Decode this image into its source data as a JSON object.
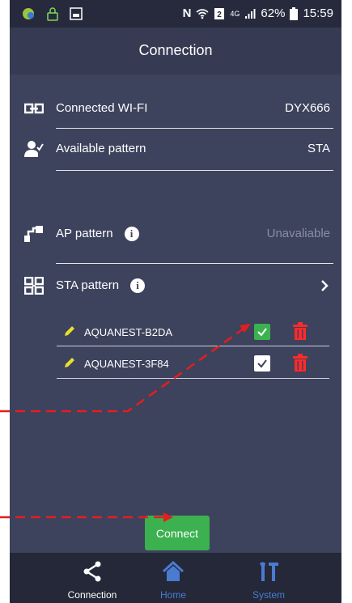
{
  "status_bar": {
    "battery_percent": "62%",
    "time": "15:59",
    "network": "4G"
  },
  "header": {
    "title": "Connection"
  },
  "info": {
    "connected_wifi_label": "Connected WI-FI",
    "connected_wifi_value": "DYX666",
    "available_pattern_label": "Available pattern",
    "available_pattern_value": "STA",
    "ap_pattern_label": "AP pattern",
    "ap_pattern_value": "Unavaliable",
    "sta_pattern_label": "STA pattern"
  },
  "wifi_list": [
    {
      "name": "AQUANEST-B2DA",
      "checked": true
    },
    {
      "name": "AQUANEST-3F84",
      "checked": false
    }
  ],
  "connect_button": "Connect",
  "bottom_nav": [
    {
      "label": "Connection",
      "active": true
    },
    {
      "label": "Home",
      "active": false
    },
    {
      "label": "System",
      "active": false
    }
  ],
  "colors": {
    "background": "#3d425d",
    "accent_green": "#3bb14f",
    "delete_red": "#ff2a2a",
    "pencil_yellow": "#e8e02a",
    "nav_inactive": "#4a7bd1",
    "annotation_arrow": "#e41e1e"
  }
}
